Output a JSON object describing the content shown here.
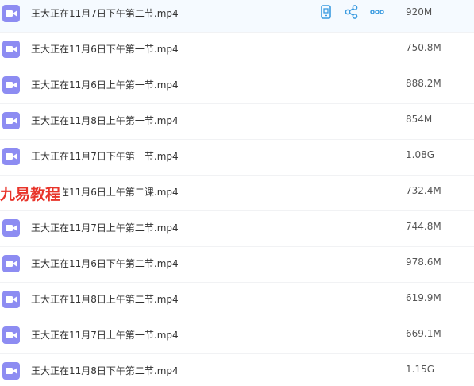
{
  "watermark": "九易教程",
  "colors": {
    "icon_bg": "#8d8cf2",
    "action_blue": "#3b9be0",
    "watermark_red": "#e8342a",
    "hover_row_bg": "#f5faff"
  },
  "row_actions": {
    "icons": [
      "phone-icon",
      "share-icon",
      "more-icon"
    ]
  },
  "files": [
    {
      "name": "王大正在11月7日下午第二节.mp4",
      "size": "920M",
      "icon": "video-file-icon"
    },
    {
      "name": "王大正在11月6日下午第一节.mp4",
      "size": "750.8M",
      "icon": "video-file-icon"
    },
    {
      "name": "王大正在11月6日上午第一节.mp4",
      "size": "888.2M",
      "icon": "video-file-icon"
    },
    {
      "name": "王大正在11月8日上午第一节.mp4",
      "size": "854M",
      "icon": "video-file-icon"
    },
    {
      "name": "王大正在11月7日下午第一节.mp4",
      "size": "1.08G",
      "icon": "video-file-icon"
    },
    {
      "name": "王大正在11月6日上午第二课.mp4",
      "size": "732.4M",
      "icon": "video-file-icon"
    },
    {
      "name": "王大正在11月7日上午第二节.mp4",
      "size": "744.8M",
      "icon": "video-file-icon"
    },
    {
      "name": "王大正在11月6日下午第二节.mp4",
      "size": "978.6M",
      "icon": "video-file-icon"
    },
    {
      "name": "王大正在11月8日上午第二节.mp4",
      "size": "619.9M",
      "icon": "video-file-icon"
    },
    {
      "name": "王大正在11月7日上午第一节.mp4",
      "size": "669.1M",
      "icon": "video-file-icon"
    },
    {
      "name": "王大正在11月8日下午第二节.mp4",
      "size": "1.15G",
      "icon": "video-file-icon"
    }
  ]
}
